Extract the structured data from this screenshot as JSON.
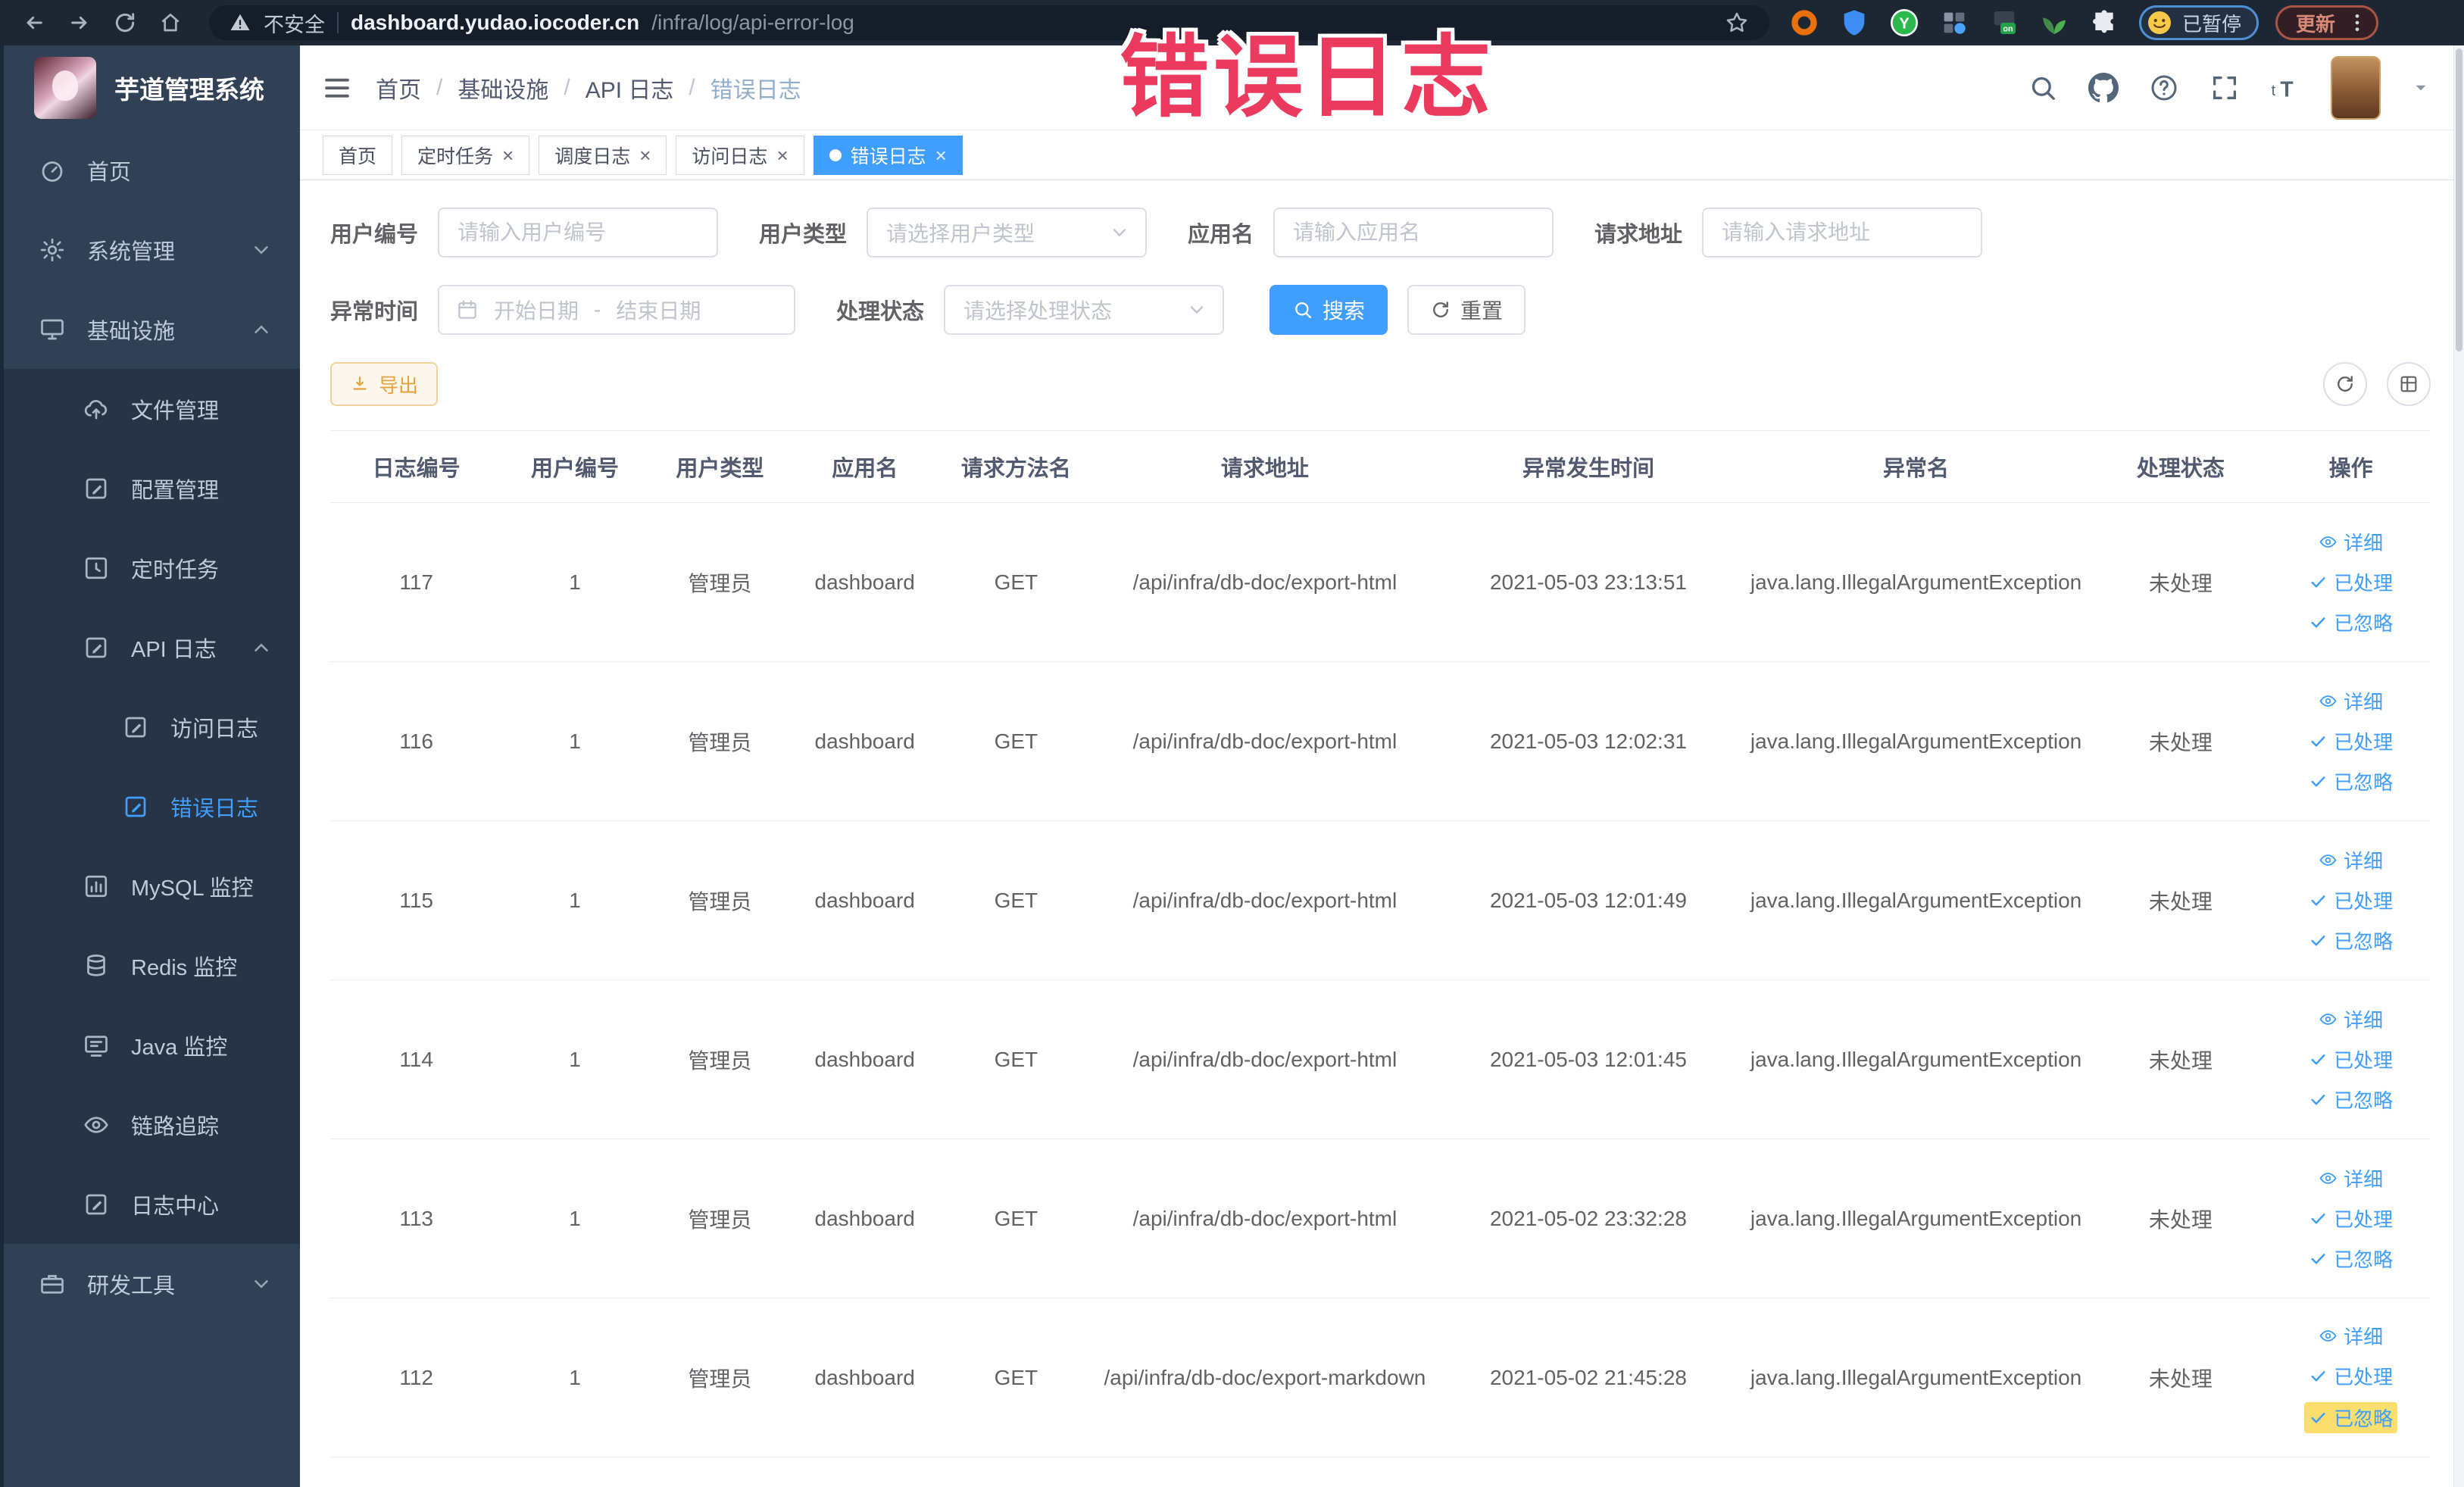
{
  "browser": {
    "security_label": "不安全",
    "url_host": "dashboard.yudao.iocoder.cn",
    "url_path": "/infra/log/api-error-log",
    "profile_chip": "已暂停",
    "update_label": "更新"
  },
  "watermark": "错误日志",
  "colors": {
    "accent": "#409eff",
    "warning": "#e6a23c",
    "watermark_pink": "#ec3a5e"
  },
  "sidebar": {
    "app_title": "芋道管理系统",
    "menu": [
      {
        "key": "home",
        "label": "首页",
        "icon": "dashboard-icon",
        "level": 1
      },
      {
        "key": "system",
        "label": "系统管理",
        "icon": "gear-icon",
        "level": 1,
        "chevron": "down"
      },
      {
        "key": "infra",
        "label": "基础设施",
        "icon": "monitor-icon",
        "level": 1,
        "chevron": "up"
      },
      {
        "key": "file",
        "label": "文件管理",
        "icon": "cloud-upload-icon",
        "level": 2
      },
      {
        "key": "config",
        "label": "配置管理",
        "icon": "edit-note-icon",
        "level": 2
      },
      {
        "key": "job",
        "label": "定时任务",
        "icon": "clock-icon",
        "level": 2
      },
      {
        "key": "api-log",
        "label": "API 日志",
        "icon": "edit-note-icon",
        "level": 2,
        "chevron": "up"
      },
      {
        "key": "access-log",
        "label": "访问日志",
        "icon": "edit-note-icon",
        "level": 3
      },
      {
        "key": "error-log",
        "label": "错误日志",
        "icon": "edit-note-icon",
        "level": 3,
        "active": true
      },
      {
        "key": "mysql",
        "label": "MySQL 监控",
        "icon": "chart-icon",
        "level": 2
      },
      {
        "key": "redis",
        "label": "Redis 监控",
        "icon": "database-icon",
        "level": 2
      },
      {
        "key": "java",
        "label": "Java 监控",
        "icon": "java-monitor-icon",
        "level": 2
      },
      {
        "key": "trace",
        "label": "链路追踪",
        "icon": "eye-icon",
        "level": 2
      },
      {
        "key": "log-center",
        "label": "日志中心",
        "icon": "edit-note-icon",
        "level": 2
      },
      {
        "key": "devtools",
        "label": "研发工具",
        "icon": "briefcase-icon",
        "level": 1,
        "chevron": "down"
      }
    ]
  },
  "breadcrumb": {
    "items": [
      "首页",
      "基础设施",
      "API 日志",
      "错误日志"
    ]
  },
  "tabs": [
    {
      "key": "home",
      "label": "首页",
      "closable": false,
      "active": false
    },
    {
      "key": "job",
      "label": "定时任务",
      "closable": true,
      "active": false
    },
    {
      "key": "job-log",
      "label": "调度日志",
      "closable": true,
      "active": false
    },
    {
      "key": "access-log",
      "label": "访问日志",
      "closable": true,
      "active": false
    },
    {
      "key": "error-log",
      "label": "错误日志",
      "closable": true,
      "active": true
    }
  ],
  "filters": {
    "row1": [
      {
        "key": "user-id",
        "label": "用户编号",
        "type": "input",
        "placeholder": "请输入用户编号"
      },
      {
        "key": "user-type",
        "label": "用户类型",
        "type": "select",
        "placeholder": "请选择用户类型"
      },
      {
        "key": "app-name",
        "label": "应用名",
        "type": "input",
        "placeholder": "请输入应用名"
      },
      {
        "key": "req-url",
        "label": "请求地址",
        "type": "input",
        "placeholder": "请输入请求地址"
      }
    ],
    "row2": [
      {
        "key": "error-time",
        "label": "异常时间",
        "type": "daterange",
        "start_placeholder": "开始日期",
        "separator": "-",
        "end_placeholder": "结束日期"
      },
      {
        "key": "status",
        "label": "处理状态",
        "type": "select",
        "placeholder": "请选择处理状态"
      }
    ],
    "search_label": "搜索",
    "reset_label": "重置"
  },
  "toolbar": {
    "export_label": "导出"
  },
  "table": {
    "headers": [
      "日志编号",
      "用户编号",
      "用户类型",
      "应用名",
      "请求方法名",
      "请求地址",
      "异常发生时间",
      "异常名",
      "处理状态",
      "操作"
    ],
    "actions": [
      "详细",
      "已处理",
      "已忽略"
    ],
    "highlight": {
      "row_index": 5,
      "action_index": 2
    },
    "rows": [
      {
        "id": "117",
        "user_id": "1",
        "user_type": "管理员",
        "app": "dashboard",
        "method": "GET",
        "url": "/api/infra/db-doc/export-html",
        "time": "2021-05-03 23:13:51",
        "exception": "java.lang.IllegalArgumentException",
        "status": "未处理"
      },
      {
        "id": "116",
        "user_id": "1",
        "user_type": "管理员",
        "app": "dashboard",
        "method": "GET",
        "url": "/api/infra/db-doc/export-html",
        "time": "2021-05-03 12:02:31",
        "exception": "java.lang.IllegalArgumentException",
        "status": "未处理"
      },
      {
        "id": "115",
        "user_id": "1",
        "user_type": "管理员",
        "app": "dashboard",
        "method": "GET",
        "url": "/api/infra/db-doc/export-html",
        "time": "2021-05-03 12:01:49",
        "exception": "java.lang.IllegalArgumentException",
        "status": "未处理"
      },
      {
        "id": "114",
        "user_id": "1",
        "user_type": "管理员",
        "app": "dashboard",
        "method": "GET",
        "url": "/api/infra/db-doc/export-html",
        "time": "2021-05-03 12:01:45",
        "exception": "java.lang.IllegalArgumentException",
        "status": "未处理"
      },
      {
        "id": "113",
        "user_id": "1",
        "user_type": "管理员",
        "app": "dashboard",
        "method": "GET",
        "url": "/api/infra/db-doc/export-html",
        "time": "2021-05-02 23:32:28",
        "exception": "java.lang.IllegalArgumentException",
        "status": "未处理"
      },
      {
        "id": "112",
        "user_id": "1",
        "user_type": "管理员",
        "app": "dashboard",
        "method": "GET",
        "url": "/api/infra/db-doc/export-markdown",
        "time": "2021-05-02 21:45:28",
        "exception": "java.lang.IllegalArgumentException",
        "status": "未处理"
      }
    ]
  }
}
